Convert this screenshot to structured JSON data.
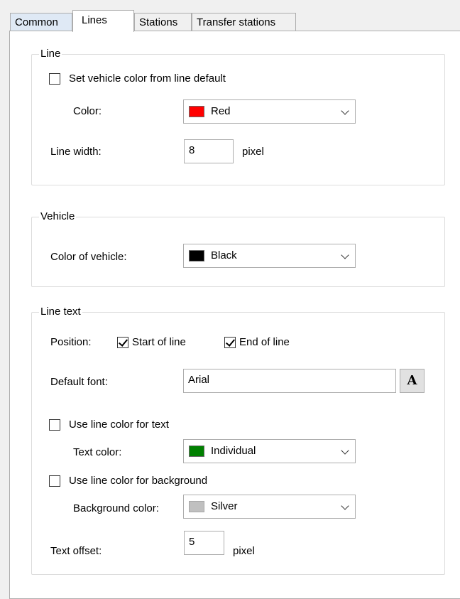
{
  "tabs": {
    "common": "Common",
    "lines": "Lines",
    "stations": "Stations",
    "transfer": "Transfer stations"
  },
  "line_group": {
    "legend": "Line",
    "set_vehicle_color_label": "Set vehicle color from line default",
    "set_vehicle_color_checked": false,
    "color_label": "Color:",
    "color_value": "Red",
    "color_swatch": "#ff0000",
    "line_width_label": "Line width:",
    "line_width_value": "8",
    "line_width_unit": "pixel"
  },
  "vehicle_group": {
    "legend": "Vehicle",
    "color_label": "Color of vehicle:",
    "color_value": "Black",
    "color_swatch": "#000000"
  },
  "line_text_group": {
    "legend": "Line text",
    "position_label": "Position:",
    "start_of_line_label": "Start of line",
    "start_of_line_checked": true,
    "end_of_line_label": "End of line",
    "end_of_line_checked": true,
    "default_font_label": "Default font:",
    "default_font_value": "Arial",
    "font_button_glyph": "A",
    "use_line_color_text_label": "Use line color for text",
    "use_line_color_text_checked": false,
    "text_color_label": "Text color:",
    "text_color_value": "Individual",
    "text_color_swatch": "#008000",
    "use_line_color_bg_label": "Use line color for background",
    "use_line_color_bg_checked": false,
    "bg_color_label": "Background color:",
    "bg_color_value": "Silver",
    "bg_color_swatch": "#c0c0c0",
    "text_offset_label": "Text offset:",
    "text_offset_value": "5",
    "text_offset_unit": "pixel"
  }
}
